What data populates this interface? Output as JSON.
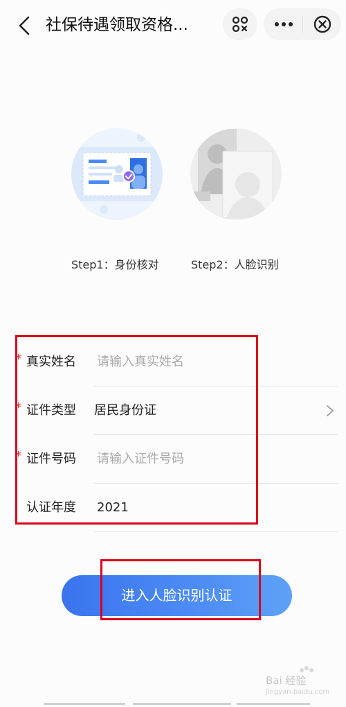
{
  "nav": {
    "title": "社保待遇领取资格...",
    "icons": {
      "back": "chevron-left-icon",
      "scan": "scan-icon",
      "more": "more-icon",
      "close": "close-circle-icon"
    }
  },
  "steps": [
    {
      "label": "Step1：身份核对",
      "icon": "id-card-illustration"
    },
    {
      "label": "Step2：人脸识别",
      "icon": "face-illustration"
    }
  ],
  "form": {
    "required_mark": "*",
    "name": {
      "label": "真实姓名",
      "placeholder": "请输入真实姓名",
      "value": ""
    },
    "id_type": {
      "label": "证件类型",
      "value": "居民身份证"
    },
    "id_number": {
      "label": "证件号码",
      "placeholder": "请输入证件号码",
      "value": ""
    },
    "year": {
      "label": "认证年度",
      "value": "2021"
    }
  },
  "cta": {
    "label": "进入人脸识别认证"
  },
  "watermark": {
    "text": "Bai 经验",
    "sub": "jingyan.baidu.com"
  },
  "colors": {
    "primary": "#3a74ee",
    "required": "#e8382f",
    "highlight": "#d9001b"
  }
}
